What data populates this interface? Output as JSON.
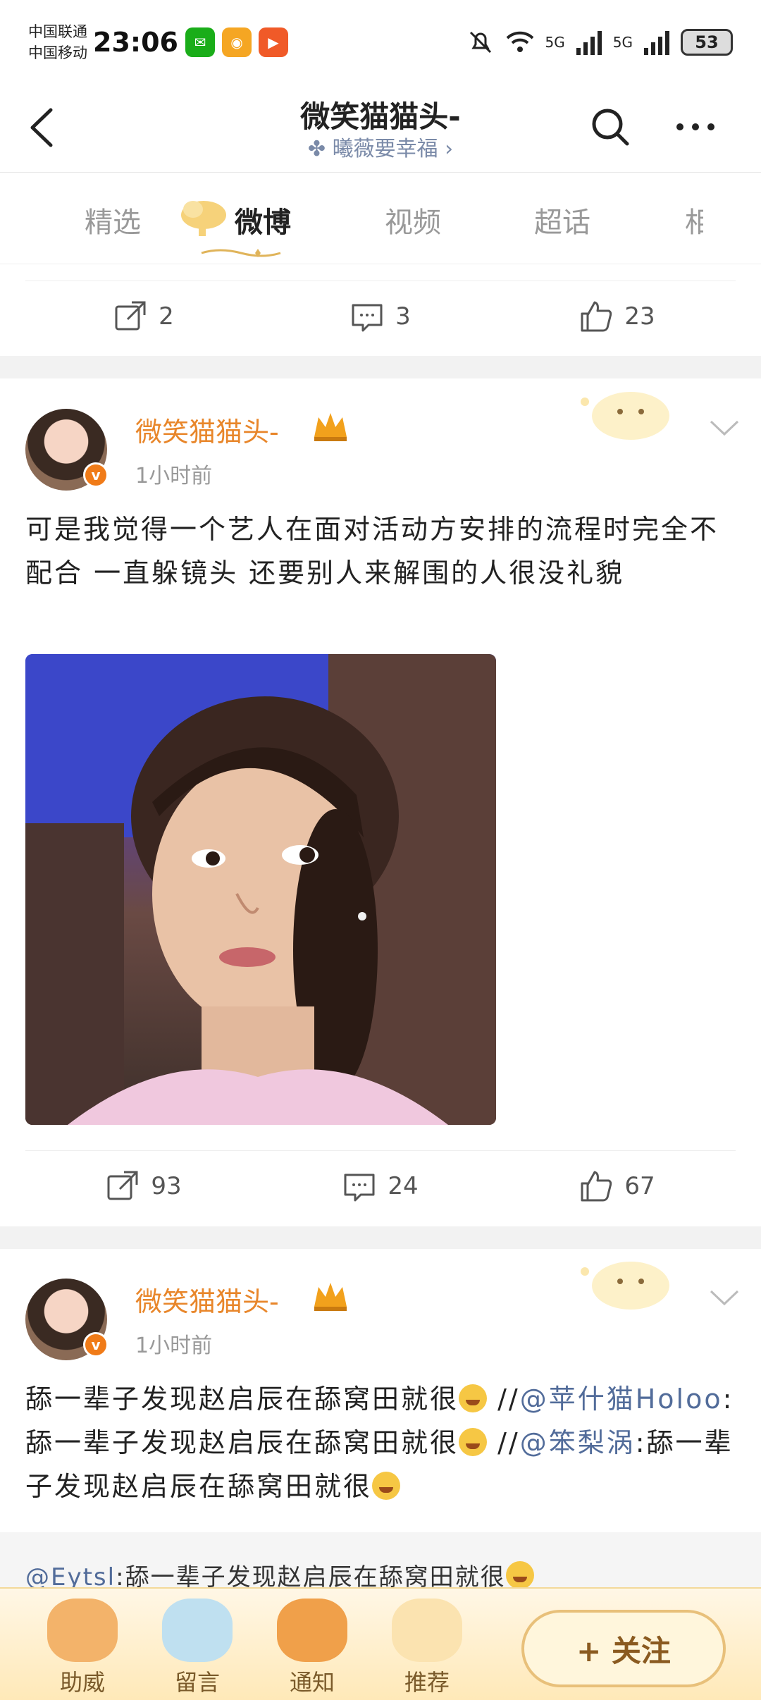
{
  "status_bar": {
    "carrier_1": "中国联通",
    "carrier_2": "中国移动",
    "time": "23:06",
    "signal_1": "5G",
    "signal_2": "5G",
    "battery": "53"
  },
  "header": {
    "title": "微笑猫猫头-",
    "subtitle": "曦薇要幸福 ›"
  },
  "tabs": [
    {
      "label": "精选"
    },
    {
      "label": "微博"
    },
    {
      "label": "视频"
    },
    {
      "label": "超话"
    },
    {
      "label": "相"
    }
  ],
  "prev_post_actions": {
    "share": "2",
    "comment": "3",
    "like": "23"
  },
  "posts": [
    {
      "username": "微笑猫猫头-",
      "time": "1小时前",
      "text": "可是我觉得一个艺人在面对活动方安排的流程时完全不配合 一直躲镜头 还要别人来解围的人很没礼貌",
      "actions": {
        "share": "93",
        "comment": "24",
        "like": "67"
      }
    },
    {
      "username": "微笑猫猫头-",
      "time": "1小时前",
      "text_parts": {
        "a": "舔一辈子发现赵启辰在舔窝田就很",
        "b": " //",
        "c": "@苹什猫Holoo",
        "d": ":舔一辈子发现赵启辰在舔窝田就很",
        "e": " //",
        "f": "@笨梨涡",
        "g": ":舔一辈子发现赵启辰在舔窝田就很"
      },
      "quote_user": "@Eytsl",
      "quote_text": ":舔一辈子发现赵启辰在舔窝田就很"
    }
  ],
  "bottom_bar": {
    "items": [
      {
        "label": "助威",
        "icon": "basket-icon"
      },
      {
        "label": "留言",
        "icon": "picture-icon"
      },
      {
        "label": "通知",
        "icon": "leaf-icon"
      },
      {
        "label": "推荐",
        "icon": "hamster-icon"
      }
    ],
    "follow_label": "+ 关注"
  },
  "colors": {
    "accent_orange": "#e8862a",
    "mention_blue": "#526c9a",
    "bottom_bg": "#ffe9b8"
  }
}
